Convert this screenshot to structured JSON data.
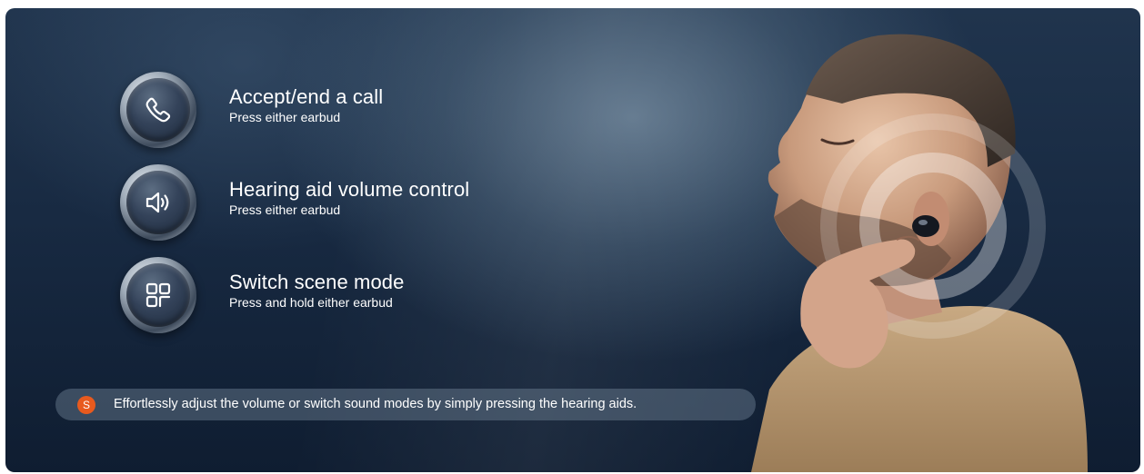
{
  "features": [
    {
      "title": "Accept/end a call",
      "subtitle": "Press either earbud",
      "icon": "phone-icon"
    },
    {
      "title": "Hearing aid volume control",
      "subtitle": "Press either earbud",
      "icon": "speaker-volume-icon"
    },
    {
      "title": "Switch scene mode",
      "subtitle": "Press and hold either earbud",
      "icon": "grid-mode-icon"
    }
  ],
  "caption": {
    "badge": "S",
    "text": "Effortlessly adjust the volume or switch sound modes by simply pressing the hearing aids."
  },
  "colors": {
    "background_dark": "#0f1d31",
    "background_light": "#5c7a94",
    "badge": "#e85a1e",
    "text": "#ffffff"
  }
}
